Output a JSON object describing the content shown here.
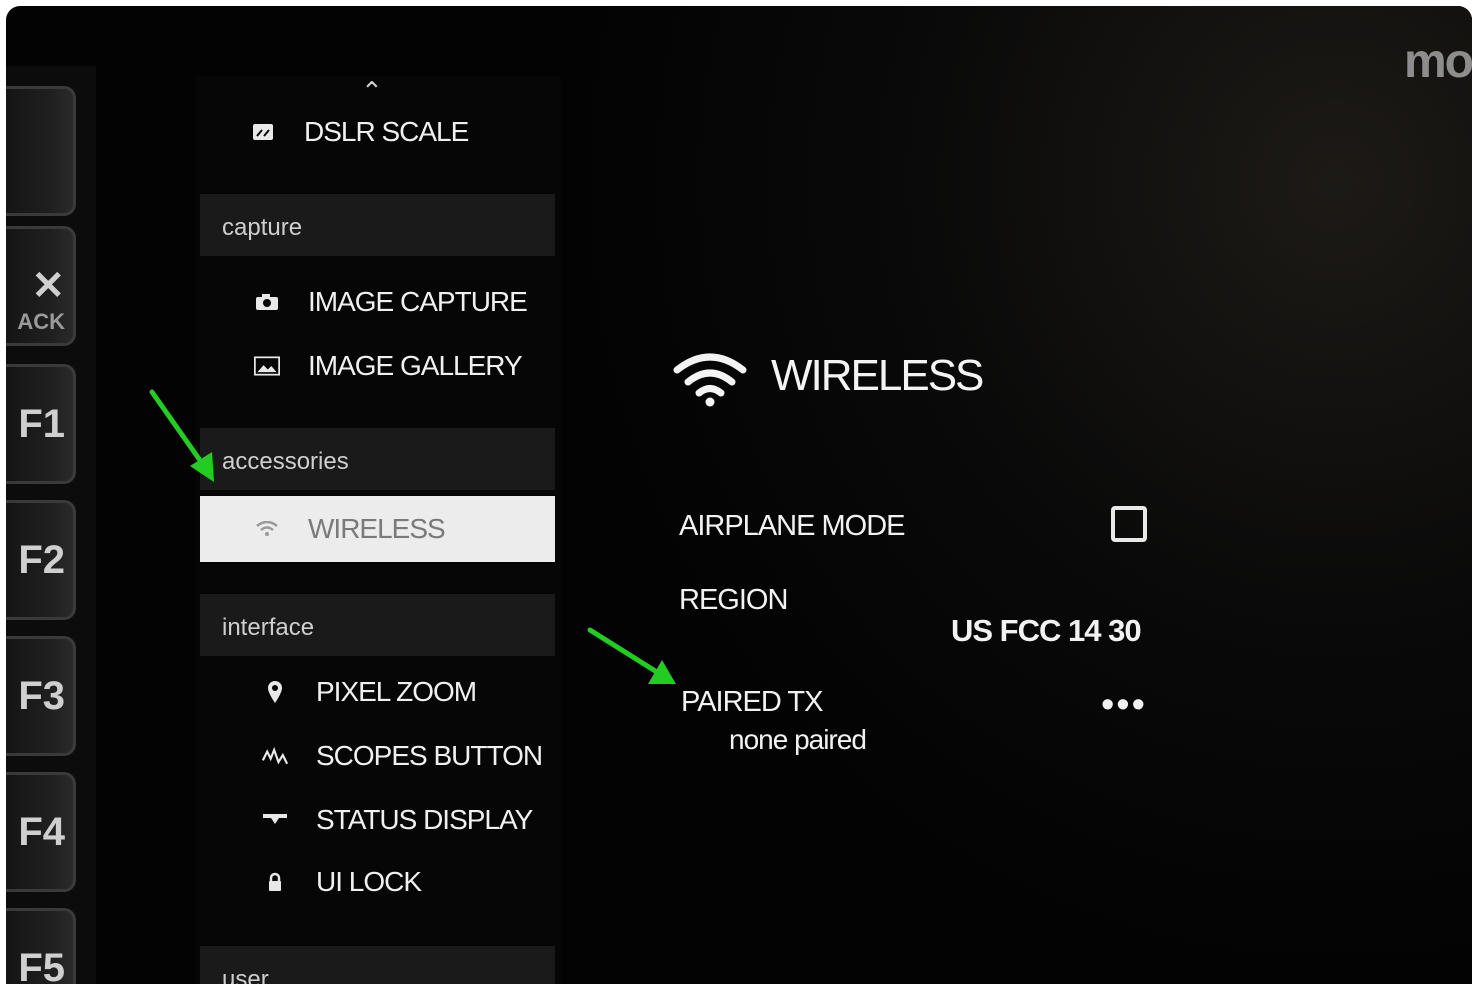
{
  "hardware_keys": [
    {
      "label": "",
      "sub": ""
    },
    {
      "label": "✕",
      "sub": "ACK"
    },
    {
      "label": "F1",
      "sub": ""
    },
    {
      "label": "F2",
      "sub": ""
    },
    {
      "label": "F3",
      "sub": ""
    },
    {
      "label": "F4",
      "sub": ""
    },
    {
      "label": "F5",
      "sub": ""
    }
  ],
  "menu": {
    "scroll_up_icon": "chevron-up-icon",
    "top_item": {
      "label": "DSLR SCALE",
      "icon": "scale-icon"
    },
    "sections": [
      {
        "label": "capture",
        "items": [
          {
            "label": "IMAGE CAPTURE",
            "icon": "camera-icon"
          },
          {
            "label": "IMAGE GALLERY",
            "icon": "image-gallery-icon"
          }
        ]
      },
      {
        "label": "accessories",
        "items": [
          {
            "label": "WIRELESS",
            "icon": "wifi-icon",
            "selected": true
          }
        ]
      },
      {
        "label": "interface",
        "items": [
          {
            "label": "PIXEL ZOOM",
            "icon": "pin-icon"
          },
          {
            "label": "SCOPES BUTTON",
            "icon": "waveform-icon"
          },
          {
            "label": "STATUS DISPLAY",
            "icon": "status-bar-icon"
          },
          {
            "label": "UI LOCK",
            "icon": "lock-icon"
          }
        ]
      },
      {
        "label": "user",
        "items": []
      }
    ]
  },
  "panel": {
    "brand": "mo",
    "title": "WIRELESS",
    "title_icon": "wifi-icon",
    "settings": {
      "airplane_mode": {
        "label": "AIRPLANE MODE",
        "checked": false
      },
      "region": {
        "label": "REGION",
        "value": "US FCC 14 30"
      },
      "paired_tx": {
        "label": "PAIRED TX",
        "value": "none paired",
        "action": "•••"
      }
    }
  },
  "annotations": {
    "arrow_color": "#22cc22"
  }
}
